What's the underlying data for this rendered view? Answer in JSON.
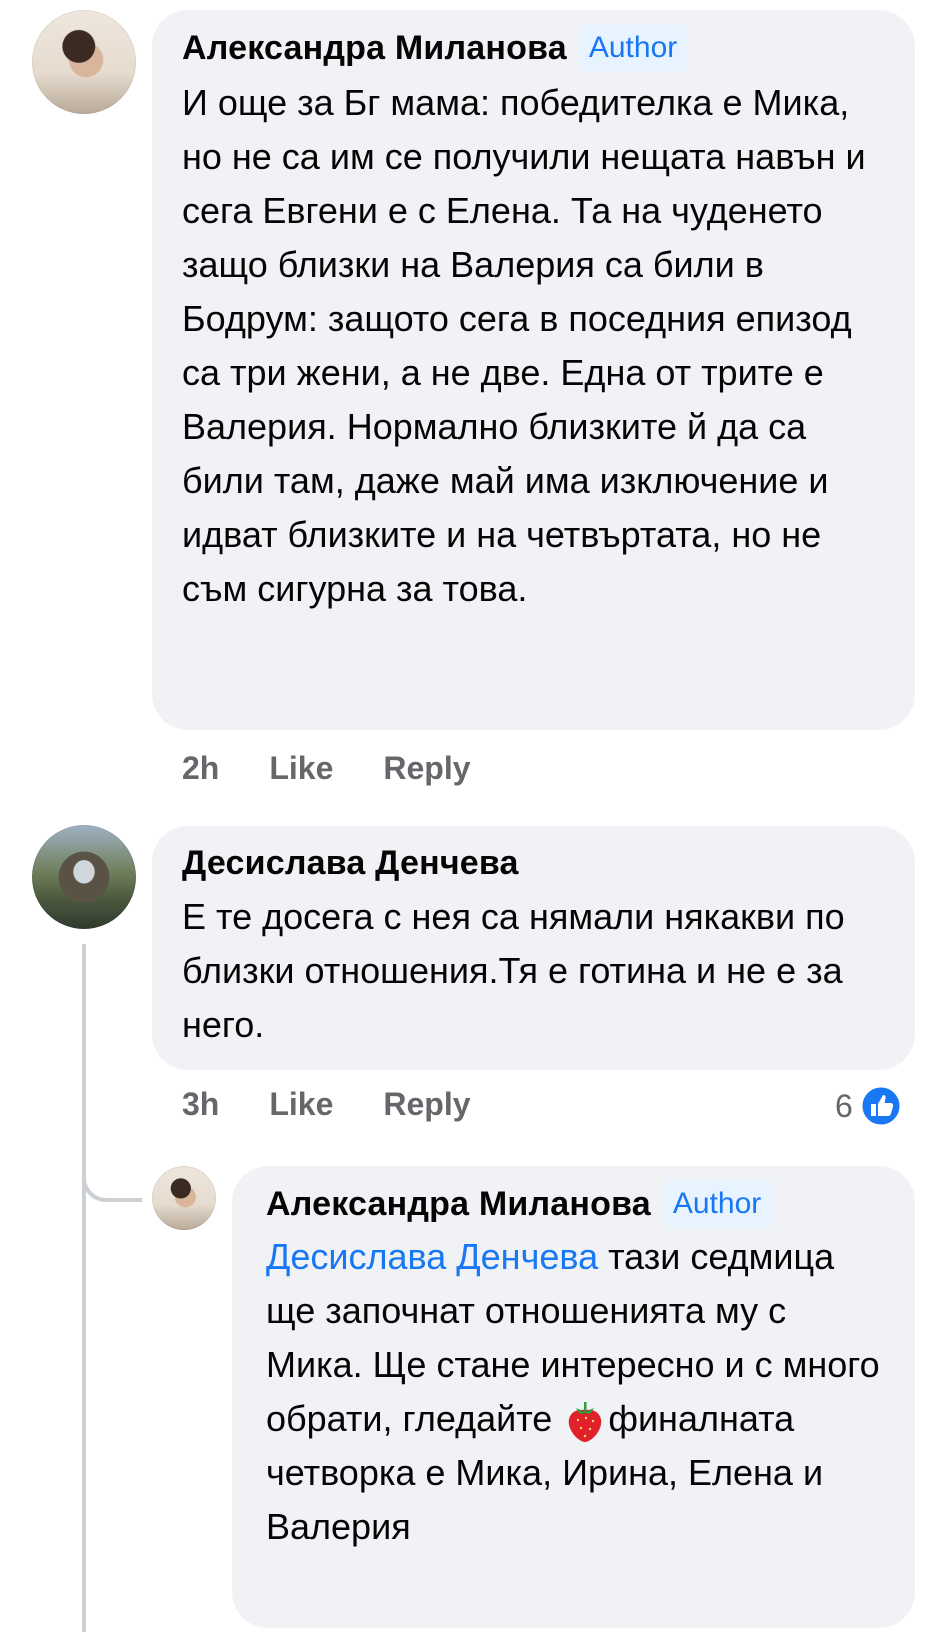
{
  "comments": [
    {
      "author": "Александра Миланова",
      "badge": "Author",
      "text": "И още за Бг мама: победителка е Мика, но не са им се получили нещата навън и сега Евгени е с Елена. Та на чуденето защо близки на Валерия са били в Бодрум: защото сега в поседния епизод са три жени, а не две. Една от трите е Валерия. Нормално близките й да са били там, даже май има изключение и идват близките и на четвъртата, но не съм сигурна за това.",
      "time": "2h",
      "like_label": "Like",
      "reply_label": "Reply"
    },
    {
      "author": "Десислава Денчева",
      "text": "Е те досега с нея са нямали някакви по близки отношения.Тя е готина и не е за него.",
      "time": "3h",
      "like_label": "Like",
      "reply_label": "Reply",
      "reaction_count": "6",
      "reaction_icon": "like-reaction-icon"
    }
  ],
  "reply": {
    "author": "Александра Миланова",
    "badge": "Author",
    "mention": "Десислава Денчева",
    "text_before_emoji": " тази седмица ще започнат отношенията му с Мика.  Ще стане интересно и с много обрати, гледайте ",
    "emoji": "strawberry-emoji",
    "text_after_emoji": "финалната четворка е Мика, Ирина, Елена и Валерия"
  },
  "colors": {
    "bubble_bg": "#f0f2f5",
    "accent": "#1877f2",
    "meta_text": "#65676b"
  }
}
